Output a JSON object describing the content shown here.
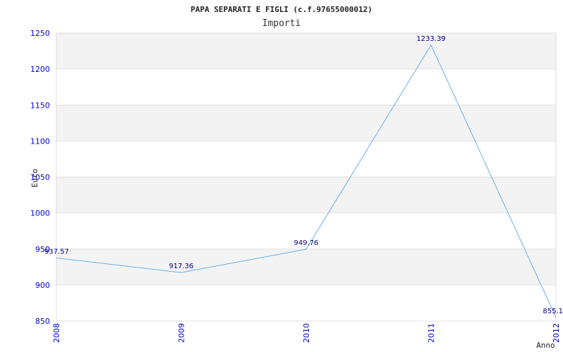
{
  "chart_data": {
    "type": "line",
    "title": "PAPA SEPARATI E FIGLI (c.f.97655000012)",
    "subtitle": "Importi",
    "xlabel": "Anno",
    "ylabel": "Euro",
    "categories": [
      "2008",
      "2009",
      "2010",
      "2011",
      "2012"
    ],
    "values": [
      937.57,
      917.36,
      949.76,
      1233.39,
      855.1
    ],
    "data_labels": [
      "937.57",
      "917.36",
      "949.76",
      "1233.39",
      "855.1"
    ],
    "ylim": [
      850,
      1250
    ],
    "yticks": [
      850,
      900,
      950,
      1000,
      1050,
      1100,
      1150,
      1200,
      1250
    ],
    "grid": true,
    "band_colors": [
      "#f3f3f3",
      "#ffffff"
    ],
    "line_color": "#6aaeea",
    "tick_color": "#0000cc",
    "label_color": "#000080"
  }
}
